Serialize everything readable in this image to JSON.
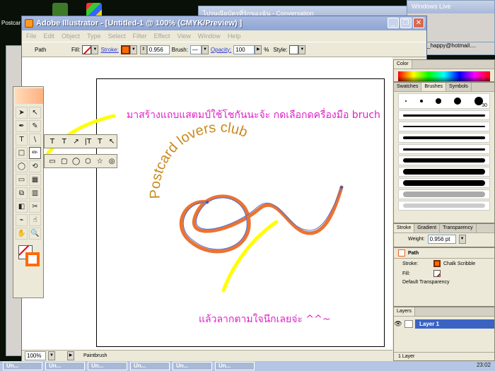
{
  "desktop": {
    "icon_label": "Postcar",
    "bg_window_1_title": "ไปรษณียบัตรที่รักของฉัน - Conversation",
    "bg_window_2_title": "Windows Live",
    "email_fragment": "_happy@hotmail...."
  },
  "app": {
    "title": "Adobe Illustrator - [Untitled-1 @ 100% (CMYK/Preview) ]",
    "menus": [
      "File",
      "Edit",
      "Object",
      "Type",
      "Select",
      "Filter",
      "Effect",
      "View",
      "Window",
      "Help"
    ]
  },
  "control_bar": {
    "selection": "Path",
    "fill_label": "Fill:",
    "stroke_label": "Stroke:",
    "stroke_weight": "0.956",
    "brush_label": "Brush:",
    "opacity_label": "Opacity:",
    "opacity_value": "100",
    "opacity_unit": "%",
    "style_label": "Style:"
  },
  "artwork": {
    "arc_text": "Postcard lovers club",
    "annotation_top": "มาสร้างแถบแสตมป์ใช้โชกันนะจ้ะ  กดเลือกดครื่องมือ  bruch",
    "annotation_bottom": "แล้วลากตามใจนึกเลยจ่ะ ^^~",
    "colors": {
      "stroke": "#e8641c",
      "text": "#c98a1e",
      "annotation": "#e020c8",
      "pointer": "#ffff00"
    }
  },
  "toolbox": {
    "tools": [
      "➤",
      "↖",
      "✒",
      "✎",
      "T",
      "\\",
      "□",
      "✏",
      "◯",
      "⟲",
      "▭",
      "▦",
      "⧉",
      "▥",
      "◧",
      "✂",
      "⌁",
      "☝",
      "✋",
      "🔍"
    ]
  },
  "type_subpanel": [
    "T",
    "T",
    "↗",
    "|T",
    "T",
    "↖"
  ],
  "shape_subpanel": [
    "▭",
    "▢",
    "◯",
    "⬡",
    "☆",
    "◎"
  ],
  "status": {
    "zoom": "100%",
    "tool": "Paintbrush"
  },
  "panels": {
    "color_tab": "Color",
    "brush_tabs": [
      "Swatches",
      "Brushes",
      "Symbols"
    ],
    "brush_size_label": "30",
    "stroke_tabs": [
      "Stroke",
      "Gradient",
      "Transparency"
    ],
    "weight_label": "Weight:",
    "weight_value": "0.956 pt",
    "appearance_title": "Path",
    "appearance_stroke_label": "Stroke:",
    "appearance_stroke_value": "Chalk Scribble",
    "appearance_fill_label": "Fill:",
    "appearance_transparency": "Default Transparency",
    "layers_tab": "Layers",
    "layer_name": "Layer 1",
    "layer_count": "1 Layer"
  },
  "taskbar": {
    "buttons": [
      "Un...",
      "Un...",
      "Un...",
      "Un...",
      "Un...",
      "Un..."
    ],
    "clock": "23:02"
  }
}
